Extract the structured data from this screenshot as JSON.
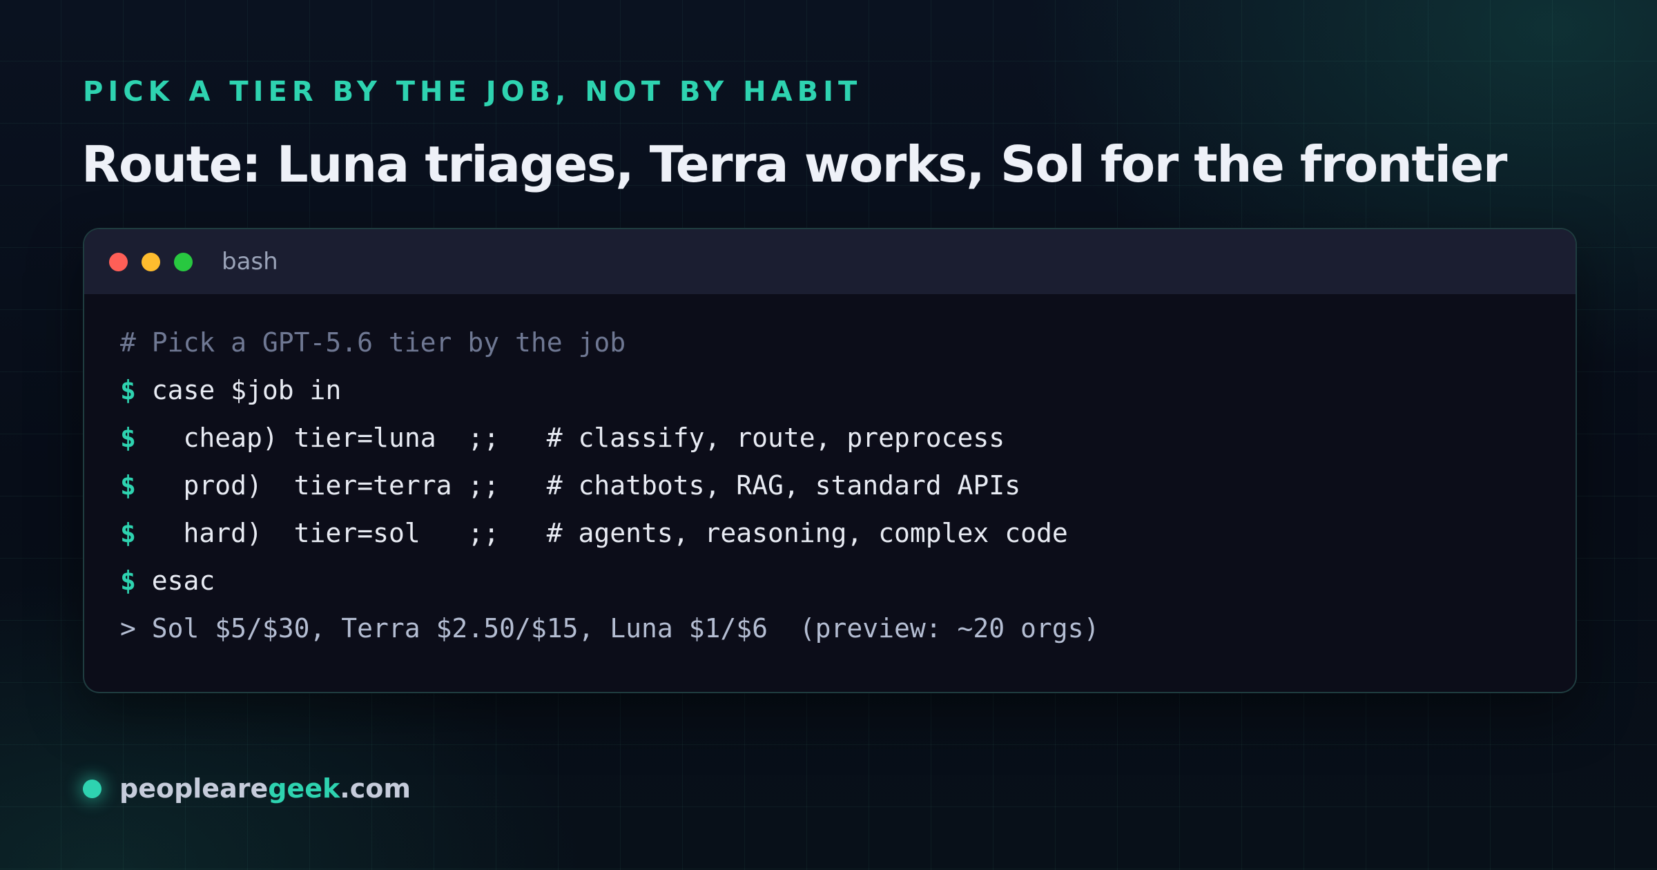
{
  "eyebrow": "PICK A TIER BY THE JOB, NOT BY HABIT",
  "title": "Route: Luna triages, Terra works, Sol for the frontier",
  "terminal": {
    "tab_title": "bash",
    "prompt_symbol": "$",
    "comment": "# Pick a GPT-5.6 tier by the job",
    "commands": [
      "case $job in",
      "  cheap) tier=luna  ;;   # classify, route, preprocess",
      "  prod)  tier=terra ;;   # chatbots, RAG, standard APIs",
      "  hard)  tier=sol   ;;   # agents, reasoning, complex code",
      "esac"
    ],
    "output": "> Sol $5/$30, Terra $2.50/$15, Luna $1/$6  (preview: ~20 orgs)"
  },
  "footer": {
    "brand_prefix": "peopleare",
    "brand_accent": "geek",
    "brand_suffix": ".com"
  },
  "colors": {
    "accent": "#2ed3b0",
    "title_text": "#eef1f8",
    "terminal_bg": "#0c0d19",
    "titlebar_bg": "#1b1e31",
    "dot_red": "#fe5f57",
    "dot_yellow": "#febc2e",
    "dot_green": "#28c840"
  }
}
